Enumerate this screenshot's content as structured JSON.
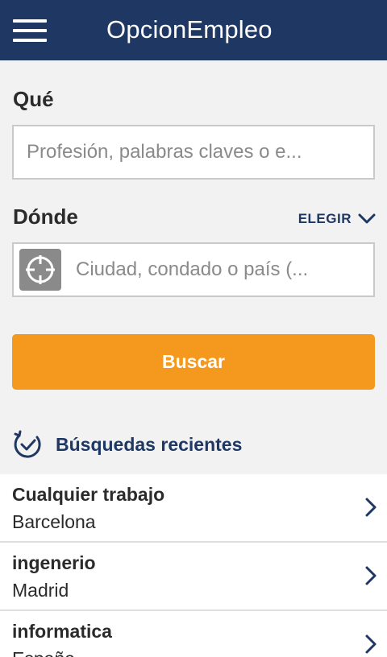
{
  "app": {
    "title": "OpcionEmpleo"
  },
  "what": {
    "label": "Qué",
    "placeholder": "Profesión, palabras claves o e..."
  },
  "where": {
    "label": "Dónde",
    "choose_label": "ELEGIR",
    "placeholder": "Ciudad, condado o país (..."
  },
  "search_button": {
    "label": "Buscar"
  },
  "recent": {
    "title": "Búsquedas recientes",
    "items": [
      {
        "what": "Cualquier trabajo",
        "where": "Barcelona"
      },
      {
        "what": "ingenerio",
        "where": "Madrid"
      },
      {
        "what": "informatica",
        "where": "España"
      }
    ]
  },
  "colors": {
    "header_bg": "#1e3763",
    "accent_orange": "#f5981e",
    "navy_text": "#1e3763",
    "background": "#f2f2f2"
  },
  "icons": {
    "menu": "hamburger-menu-icon",
    "locate": "crosshair-icon",
    "dropdown": "chevron-down-icon",
    "recent": "clock-history-icon",
    "row": "chevron-right-icon"
  }
}
